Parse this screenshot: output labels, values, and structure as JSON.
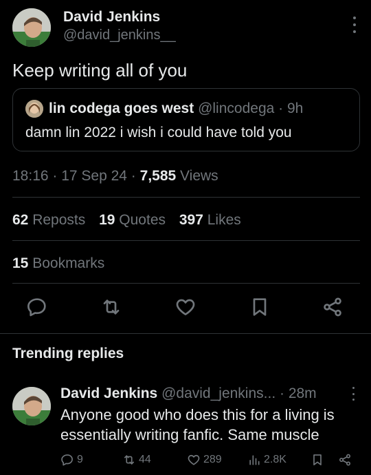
{
  "author": {
    "name": "David Jenkins",
    "handle": "@david_jenkins__"
  },
  "tweet": {
    "text": "Keep writing all of you"
  },
  "quote": {
    "name": "lin codega goes west",
    "meta": "@lincodega · 9h",
    "text": "damn lin 2022 i wish i could have told you"
  },
  "meta": {
    "time": "18:16 · 17 Sep 24 · ",
    "views_count": "7,585",
    "views_label": " Views"
  },
  "stats": {
    "reposts_count": "62",
    "reposts_label": "Reposts",
    "quotes_count": "19",
    "quotes_label": "Quotes",
    "likes_count": "397",
    "likes_label": "Likes",
    "bookmarks_count": "15",
    "bookmarks_label": "Bookmarks"
  },
  "section": {
    "title": "Trending replies"
  },
  "reply": {
    "name": "David Jenkins",
    "meta": "@david_jenkins... · 28m",
    "text": "Anyone good who does this for a living is essentially writing fanfic. Same muscle",
    "replies": "9",
    "reposts": "44",
    "likes": "289",
    "views": "2.8K"
  },
  "icons": {
    "reply": "reply-icon",
    "repost": "repost-icon",
    "like": "heart-icon",
    "bookmark": "bookmark-icon",
    "share": "share-icon",
    "views": "views-icon",
    "more": "more-icon"
  },
  "colors": {
    "background": "#000000",
    "text": "#e7e9ea",
    "muted": "#71767b",
    "divider": "#2f3336"
  }
}
